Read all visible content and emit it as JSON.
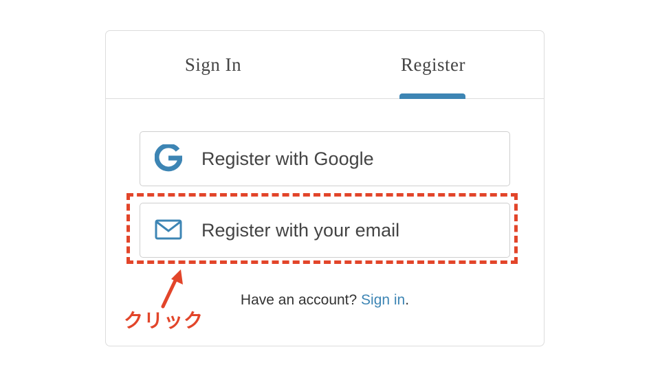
{
  "tabs": {
    "signin_label": "Sign In",
    "register_label": "Register",
    "active": "Register"
  },
  "buttons": {
    "google": {
      "label": "Register with Google",
      "icon": "google-icon"
    },
    "email": {
      "label": "Register with your email",
      "icon": "mail-icon"
    }
  },
  "footer": {
    "prompt": "Have an account? ",
    "link": "Sign in",
    "suffix": "."
  },
  "annotation": {
    "note": "クリック",
    "highlight_target": "Register with your email",
    "color": "#e2452a"
  },
  "colors": {
    "accent": "#3d85b4",
    "annotation": "#e2452a"
  }
}
